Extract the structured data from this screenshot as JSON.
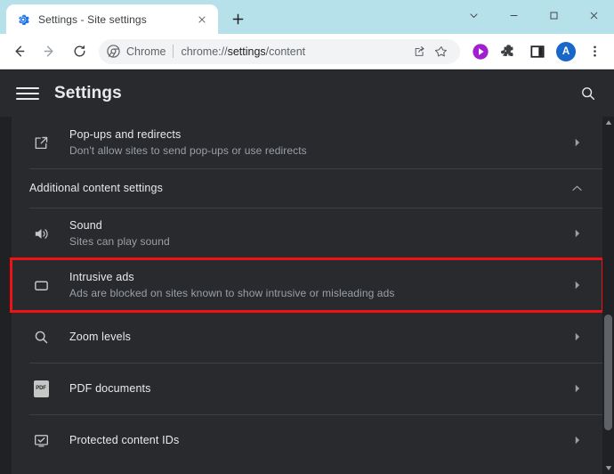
{
  "window": {
    "controls": [
      {
        "name": "tab-search",
        "label": "∨"
      },
      {
        "name": "minimize",
        "label": "—"
      },
      {
        "name": "maximize",
        "label": "□"
      },
      {
        "name": "close",
        "label": "✕"
      }
    ]
  },
  "tabstrip": {
    "tab_title": "Settings - Site settings",
    "tab_favicon": "settings-gear-icon",
    "close_label": "✕",
    "newtab_label": "+"
  },
  "toolbar": {
    "back_label": "←",
    "forward_label": "→",
    "reload_label": "⟳",
    "omnibox": {
      "chip_label": "Chrome",
      "url_prefix": "chrome://",
      "url_bold": "settings",
      "url_suffix": "/content",
      "share_icon": "share-icon",
      "bookmark_icon": "star-icon"
    },
    "icons": [
      {
        "name": "media-play-icon",
        "color": "#a020d0"
      },
      {
        "name": "extensions-puzzle-icon",
        "color": "#3c4043"
      },
      {
        "name": "side-panel-icon",
        "color": "#202124"
      }
    ],
    "avatar_letter": "A",
    "menu_label": "⋮"
  },
  "settings": {
    "title": "Settings",
    "menu_icon": "hamburger-menu-icon",
    "search_icon": "search-icon",
    "rows": [
      {
        "id": "popups-and-redirects",
        "icon": "external-link-icon",
        "title": "Pop-ups and redirects",
        "subtitle": "Don't allow sites to send pop-ups or use redirects",
        "arrow": "▸",
        "highlighted": false
      },
      {
        "id": "sound",
        "icon": "speaker-icon",
        "title": "Sound",
        "subtitle": "Sites can play sound",
        "arrow": "▸",
        "highlighted": false
      },
      {
        "id": "intrusive-ads",
        "icon": "ads-block-icon",
        "title": "Intrusive ads",
        "subtitle": "Ads are blocked on sites known to show intrusive or misleading ads",
        "arrow": "▸",
        "highlighted": true
      },
      {
        "id": "zoom-levels",
        "icon": "magnifier-icon",
        "title": "Zoom levels",
        "subtitle": "",
        "arrow": "▸",
        "highlighted": false
      },
      {
        "id": "pdf-documents",
        "icon": "pdf-icon",
        "title": "PDF documents",
        "subtitle": "",
        "arrow": "▸",
        "highlighted": false
      },
      {
        "id": "protected-content-ids",
        "icon": "protected-content-icon",
        "title": "Protected content IDs",
        "subtitle": "",
        "arrow": "▸",
        "highlighted": false
      }
    ],
    "section": {
      "label": "Additional content settings",
      "chevron": "∧",
      "expanded": true
    },
    "pdf_badge_text": "PDF"
  },
  "colors": {
    "tabstrip_bg": "#b7e1ea",
    "page_bg": "#202124",
    "card_bg": "#292a2d",
    "highlight": "#ee1212",
    "accent": "#1967c8",
    "text_primary": "#e8eaed",
    "text_secondary": "#9aa0a6"
  }
}
